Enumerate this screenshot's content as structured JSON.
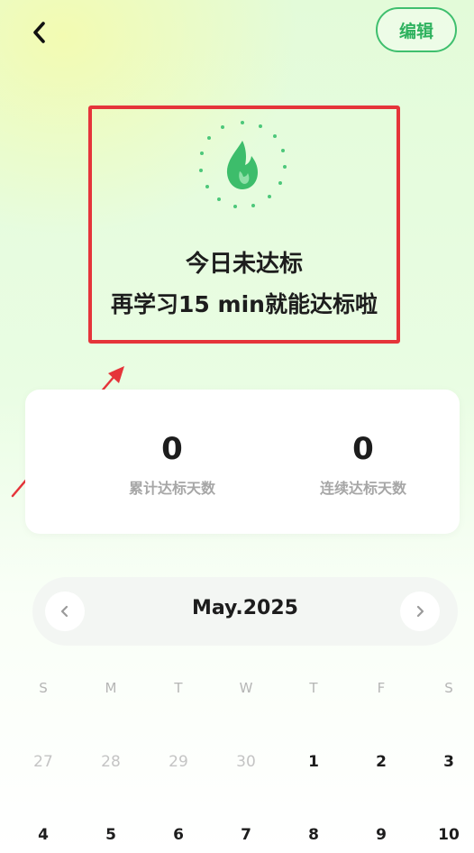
{
  "header": {
    "back_icon": "chevron-left-icon",
    "edit_label": "编辑"
  },
  "status": {
    "icon": "flame-icon",
    "title": "今日未达标",
    "subtitle": "再学习15 min就能达标啦"
  },
  "stats": {
    "total_value": "0",
    "total_label": "累计达标天数",
    "streak_value": "0",
    "streak_label": "连续达标天数"
  },
  "calendar": {
    "month": "May.2025",
    "prev_icon": "chevron-left-icon",
    "next_icon": "chevron-right-icon",
    "weekdays": [
      "S",
      "M",
      "T",
      "W",
      "T",
      "F",
      "S"
    ],
    "week1": [
      "27",
      "28",
      "29",
      "30",
      "1",
      "2",
      "3"
    ],
    "week2": [
      "4",
      "5",
      "6",
      "7",
      "8",
      "9",
      "10"
    ]
  },
  "colors": {
    "accent": "#3fbf6e",
    "highlight": "#e5343a"
  }
}
